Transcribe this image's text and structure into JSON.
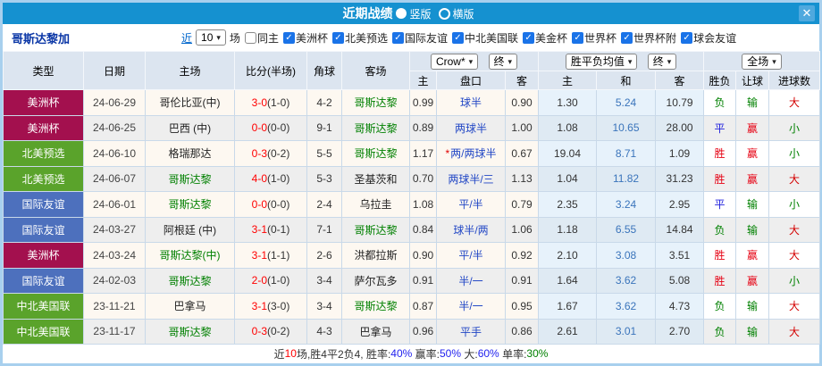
{
  "title_bar": {
    "title": "近期战绩",
    "vertical_label": "竖版",
    "horizontal_label": "横版",
    "close_icon": "✕"
  },
  "icons": {
    "caret": "▾",
    "check": "✓",
    "star": "*"
  },
  "filter": {
    "team": "哥斯达黎加",
    "near_label": "近",
    "matches_value": "10",
    "matches_suffix": "场",
    "same_host_label": "同主",
    "leagues": [
      "美洲杯",
      "北美预选",
      "国际友谊",
      "中北美国联",
      "美金杯",
      "世界杯",
      "世界杯附",
      "球会友谊"
    ]
  },
  "header": {
    "static_cols": [
      "类型",
      "日期",
      "主场",
      "比分(半场)",
      "角球",
      "客场"
    ],
    "selects": {
      "bookmaker": "Crow*",
      "bookmaker_stage": "终",
      "avg": "胜平负均值",
      "avg_stage": "终",
      "scope": "全场"
    },
    "sub_cols": [
      "主",
      "盘口",
      "客",
      "主",
      "和",
      "客",
      "胜负",
      "让球",
      "进球数"
    ]
  },
  "type_colors": {
    "美洲杯": "#a3104e",
    "北美预选": "#5aa32b",
    "国际友谊": "#4d70bd",
    "中北美国联": "#5aa32b"
  },
  "outcome_colors": {
    "胜": "#e60012",
    "平": "#2222dd",
    "负": "#008000",
    "赢": "#e60012",
    "输": "#008000",
    "大": "#d40000",
    "小": "#008000"
  },
  "rows": [
    {
      "type": "美洲杯",
      "date": "24-06-29",
      "home": "哥伦比亚(中)",
      "home_cr": false,
      "score": "3-0",
      "half": "(1-0)",
      "corner": "4-2",
      "away": "哥斯达黎",
      "away_cr": true,
      "o1": "0.99",
      "pan": "球半",
      "star": false,
      "o2": "0.90",
      "avg1": "1.30",
      "avg2": "5.24",
      "avg3": "10.79",
      "res": "负",
      "rang": "输",
      "jin": "大"
    },
    {
      "type": "美洲杯",
      "date": "24-06-25",
      "home": "巴西 (中)",
      "home_cr": false,
      "score": "0-0",
      "half": "(0-0)",
      "corner": "9-1",
      "away": "哥斯达黎",
      "away_cr": true,
      "o1": "0.89",
      "pan": "两球半",
      "star": false,
      "o2": "1.00",
      "avg1": "1.08",
      "avg2": "10.65",
      "avg3": "28.00",
      "res": "平",
      "rang": "赢",
      "jin": "小"
    },
    {
      "type": "北美预选",
      "date": "24-06-10",
      "home": "格瑞那达",
      "home_cr": false,
      "score": "0-3",
      "half": "(0-2)",
      "corner": "5-5",
      "away": "哥斯达黎",
      "away_cr": true,
      "o1": "1.17",
      "pan": "两/两球半",
      "star": true,
      "o2": "0.67",
      "avg1": "19.04",
      "avg2": "8.71",
      "avg3": "1.09",
      "res": "胜",
      "rang": "赢",
      "jin": "小"
    },
    {
      "type": "北美预选",
      "date": "24-06-07",
      "home": "哥斯达黎",
      "home_cr": true,
      "score": "4-0",
      "half": "(1-0)",
      "corner": "5-3",
      "away": "圣基茨和",
      "away_cr": false,
      "o1": "0.70",
      "pan": "两球半/三",
      "star": false,
      "o2": "1.13",
      "avg1": "1.04",
      "avg2": "11.82",
      "avg3": "31.23",
      "res": "胜",
      "rang": "赢",
      "jin": "大"
    },
    {
      "type": "国际友谊",
      "date": "24-06-01",
      "home": "哥斯达黎",
      "home_cr": true,
      "score": "0-0",
      "half": "(0-0)",
      "corner": "2-4",
      "away": "乌拉圭",
      "away_cr": false,
      "o1": "1.08",
      "pan": "平/半",
      "star": false,
      "o2": "0.79",
      "avg1": "2.35",
      "avg2": "3.24",
      "avg3": "2.95",
      "res": "平",
      "rang": "输",
      "jin": "小"
    },
    {
      "type": "国际友谊",
      "date": "24-03-27",
      "home": "阿根廷 (中)",
      "home_cr": false,
      "score": "3-1",
      "half": "(0-1)",
      "corner": "7-1",
      "away": "哥斯达黎",
      "away_cr": true,
      "o1": "0.84",
      "pan": "球半/两",
      "star": false,
      "o2": "1.06",
      "avg1": "1.18",
      "avg2": "6.55",
      "avg3": "14.84",
      "res": "负",
      "rang": "输",
      "jin": "大"
    },
    {
      "type": "美洲杯",
      "date": "24-03-24",
      "home": "哥斯达黎(中)",
      "home_cr": true,
      "score": "3-1",
      "half": "(1-1)",
      "corner": "2-6",
      "away": "洪都拉斯",
      "away_cr": false,
      "o1": "0.90",
      "pan": "平/半",
      "star": false,
      "o2": "0.92",
      "avg1": "2.10",
      "avg2": "3.08",
      "avg3": "3.51",
      "res": "胜",
      "rang": "赢",
      "jin": "大"
    },
    {
      "type": "国际友谊",
      "date": "24-02-03",
      "home": "哥斯达黎",
      "home_cr": true,
      "score": "2-0",
      "half": "(1-0)",
      "corner": "3-4",
      "away": "萨尔瓦多",
      "away_cr": false,
      "o1": "0.91",
      "pan": "半/一",
      "star": false,
      "o2": "0.91",
      "avg1": "1.64",
      "avg2": "3.62",
      "avg3": "5.08",
      "res": "胜",
      "rang": "赢",
      "jin": "小"
    },
    {
      "type": "中北美国联",
      "date": "23-11-21",
      "home": "巴拿马",
      "home_cr": false,
      "score": "3-1",
      "half": "(3-0)",
      "corner": "3-4",
      "away": "哥斯达黎",
      "away_cr": true,
      "o1": "0.87",
      "pan": "半/一",
      "star": false,
      "o2": "0.95",
      "avg1": "1.67",
      "avg2": "3.62",
      "avg3": "4.73",
      "res": "负",
      "rang": "输",
      "jin": "大"
    },
    {
      "type": "中北美国联",
      "date": "23-11-17",
      "home": "哥斯达黎",
      "home_cr": true,
      "score": "0-3",
      "half": "(0-2)",
      "corner": "4-3",
      "away": "巴拿马",
      "away_cr": false,
      "o1": "0.96",
      "pan": "平手",
      "star": false,
      "o2": "0.86",
      "avg1": "2.61",
      "avg2": "3.01",
      "avg3": "2.70",
      "res": "负",
      "rang": "输",
      "jin": "大"
    }
  ],
  "footer": {
    "segments": [
      {
        "text": "近",
        "color": "#333333"
      },
      {
        "text": "10",
        "color": "#ff0000"
      },
      {
        "text": "场,胜4平2负4, 胜率:",
        "color": "#333333"
      },
      {
        "text": "40%",
        "color": "#2222ee"
      },
      {
        "text": " 赢率:",
        "color": "#333333"
      },
      {
        "text": "50%",
        "color": "#2222ee"
      },
      {
        "text": " 大:",
        "color": "#333333"
      },
      {
        "text": "60%",
        "color": "#2222ee"
      },
      {
        "text": " 单率:",
        "color": "#333333"
      },
      {
        "text": "30%",
        "color": "#008000"
      }
    ]
  }
}
